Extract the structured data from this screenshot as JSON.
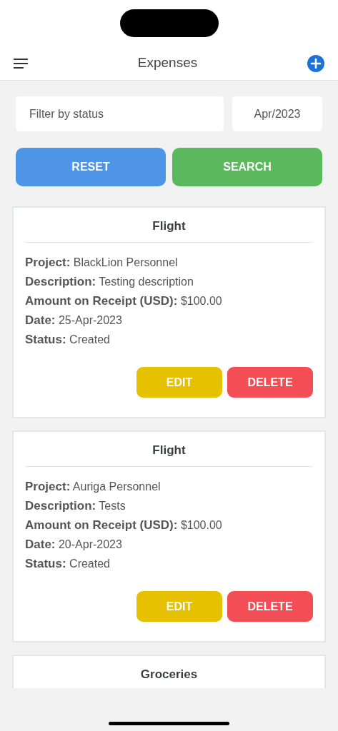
{
  "header": {
    "title": "Expenses"
  },
  "filters": {
    "status_placeholder": "Filter by status",
    "month": "Apr/2023"
  },
  "actions": [
    {
      "label": "RESET",
      "kind": "reset"
    },
    {
      "label": "SEARCH",
      "kind": "search"
    }
  ],
  "expenses": [
    {
      "title": "Flight",
      "details": [
        "**Project:** BlackLion Personnel",
        "**Description:** Testing description",
        "**Amount on Receipt (USD):** $100.00",
        "**Date:** 25-Apr-2023",
        "**Status:** Created"
      ],
      "buttons": [
        {
          "label": "EDIT",
          "kind": "edit"
        },
        {
          "label": "DELETE",
          "kind": "delete"
        }
      ]
    },
    {
      "title": "Flight",
      "details": [
        "**Project:** Auriga Personnel",
        "**Description:** Tests",
        "**Amount on Receipt (USD):** $100.00",
        "**Date:** 20-Apr-2023",
        "**Status:** Created"
      ],
      "buttons": [
        {
          "label": "EDIT",
          "kind": "edit"
        },
        {
          "label": "DELETE",
          "kind": "delete"
        }
      ]
    },
    {
      "title": "Groceries"
    }
  ]
}
